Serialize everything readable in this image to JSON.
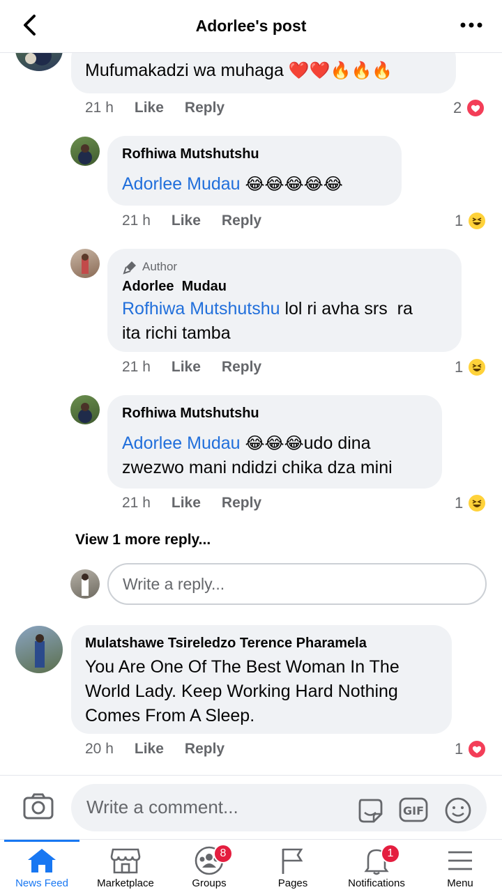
{
  "header": {
    "title": "Adorlee's post",
    "back_icon": "back-chevron-icon",
    "more_icon": "more-dots-icon"
  },
  "comments": [
    {
      "text": "Mufumakadzi wa muhaga",
      "emoji": "❤️❤️🔥🔥🔥",
      "time": "21 h",
      "like": "Like",
      "reply": "Reply",
      "reaction_count": "2",
      "reaction": "love"
    },
    {
      "name": "Rofhiwa Mutshutshu",
      "mention": "Adorlee Mudau",
      "emoji": "😂😂😂😂😂",
      "time": "21 h",
      "like": "Like",
      "reply": "Reply",
      "reaction_count": "1",
      "reaction": "haha"
    },
    {
      "author_label": "Author",
      "name": "Adorlee  Mudau",
      "mention": "Rofhiwa Mutshutshu",
      "text_after_mention": " lol ri avha srs  ra",
      "text_line2": "ita richi tamba",
      "time": "21 h",
      "like": "Like",
      "reply": "Reply",
      "reaction_count": "1",
      "reaction": "haha"
    },
    {
      "name": "Rofhiwa Mutshutshu",
      "mention": "Adorlee Mudau",
      "emoji": "😂😂😂",
      "text_after_emoji": "udo dina",
      "text_line2": "zwezwo mani ndidzi chika dza mini",
      "time": "21 h",
      "like": "Like",
      "reply": "Reply",
      "reaction_count": "1",
      "reaction": "haha"
    },
    {
      "name": "Mulatshawe Tsireledzo Terence Pharamela",
      "lines": [
        "You Are One Of The Best Woman In The",
        "World Lady. Keep Working Hard Nothing",
        "Comes From A Sleep."
      ],
      "time": "20 h",
      "like": "Like",
      "reply": "Reply",
      "reaction_count": "1",
      "reaction": "love"
    }
  ],
  "view_more": "View 1 more reply...",
  "reply_placeholder": "Write a reply...",
  "composer": {
    "placeholder": "Write a comment..."
  },
  "tabs": [
    {
      "label": "News Feed",
      "icon": "home-icon",
      "active": true
    },
    {
      "label": "Marketplace",
      "icon": "marketplace-icon"
    },
    {
      "label": "Groups",
      "icon": "groups-icon",
      "badge": "8"
    },
    {
      "label": "Pages",
      "icon": "pages-flag-icon"
    },
    {
      "label": "Notifications",
      "icon": "bell-icon",
      "badge": "1"
    },
    {
      "label": "Menu",
      "icon": "menu-icon"
    }
  ],
  "colors": {
    "accent": "#1877f2",
    "mention": "#216fdb",
    "bubble": "#f0f2f5",
    "badge": "#e41e3f",
    "meta": "#65676b"
  }
}
